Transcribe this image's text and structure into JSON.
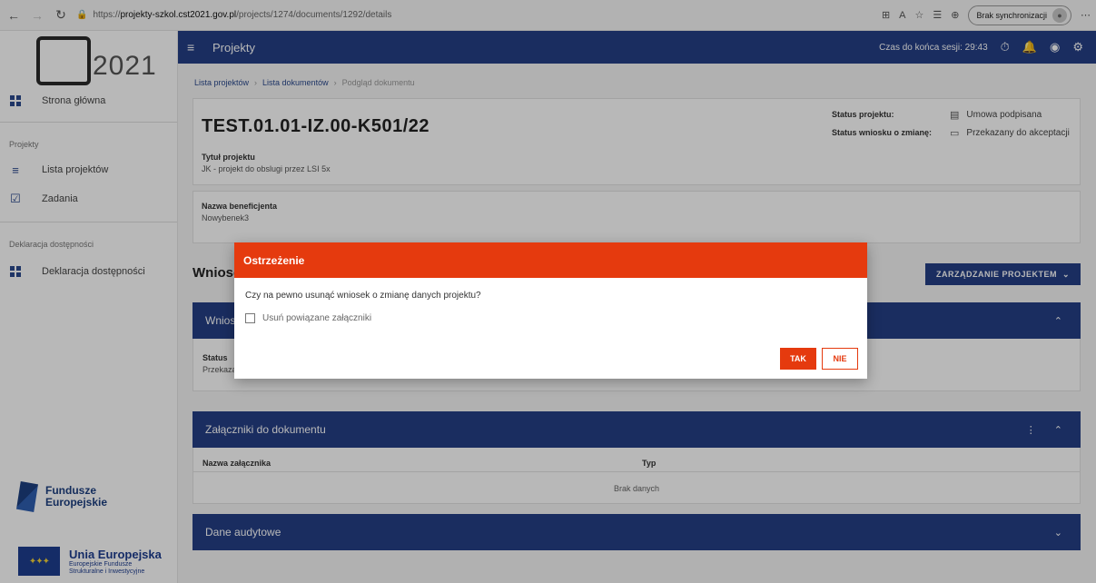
{
  "browser": {
    "url_prefix": "https://",
    "url_host": "projekty-szkol.cst2021.gov.pl",
    "url_path": "/projects/1274/documents/1292/details",
    "sync_label": "Brak synchronizacji"
  },
  "sidebar": {
    "logo_year": "2021",
    "items": [
      {
        "label": "Strona główna"
      },
      {
        "label": "Lista projektów"
      },
      {
        "label": "Zadania"
      },
      {
        "label": "Deklaracja dostępności"
      }
    ],
    "section_projects": "Projekty",
    "section_accessibility": "Deklaracja dostępności",
    "fe_line1": "Fundusze",
    "fe_line2": "Europejskie",
    "ue_title": "Unia Europejska",
    "ue_sub1": "Europejskie Fundusze",
    "ue_sub2": "Strukturalne i Inwestycyjne"
  },
  "appbar": {
    "title": "Projekty",
    "session": "Czas do końca sesji: 29:43"
  },
  "breadcrumb": {
    "items": [
      "Lista projektów",
      "Lista dokumentów",
      "Podgląd dokumentu"
    ]
  },
  "document": {
    "title": "TEST.01.01-IZ.00-K501/22",
    "status_project_label": "Status projektu:",
    "status_project_value": "Umowa podpisana",
    "status_change_label": "Status wniosku o zmianę:",
    "status_change_value": "Przekazany do akceptacji",
    "project_title_label": "Tytuł projektu",
    "project_title_value": "JK - projekt do obslugi przez LSI 5x",
    "beneficiary_label": "Nazwa beneficjenta",
    "beneficiary_value": "Nowybenek3"
  },
  "main": {
    "wnios_heading": "Wniosek",
    "manage_button": "ZARZĄDZANIE PROJEKTEM",
    "section_wnios_title": "Wniosek",
    "status_label": "Status",
    "status_value": "Przekazany",
    "attachments_title": "Załączniki do dokumentu",
    "col_name": "Nazwa załącznika",
    "col_type": "Typ",
    "no_data": "Brak danych",
    "audit_title": "Dane audytowe"
  },
  "modal": {
    "title": "Ostrzeżenie",
    "message": "Czy na pewno usunąć wniosek o zmianę danych projektu?",
    "checkbox_label": "Usuń powiązane załączniki",
    "yes": "TAK",
    "no": "NIE"
  },
  "colors": {
    "primary": "#243f86",
    "danger": "#e53a0e"
  }
}
